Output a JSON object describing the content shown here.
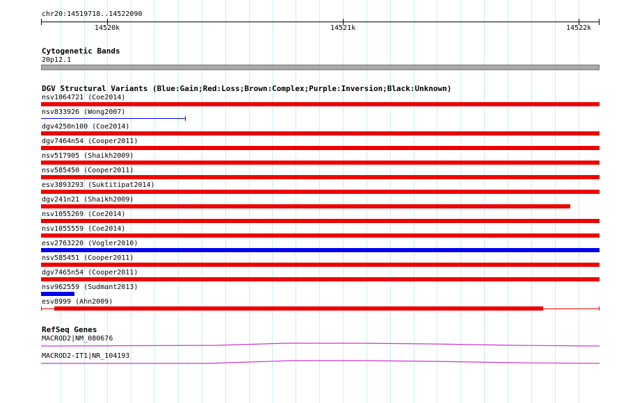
{
  "ruler": {
    "region": "chr20:14519718..14522090",
    "ticks": [
      {
        "label": "14520k",
        "pos": 14520000
      },
      {
        "label": "14521k",
        "pos": 14521000
      },
      {
        "label": "14522k",
        "pos": 14522000
      }
    ]
  },
  "view": {
    "start": 14519718,
    "end": 14522090
  },
  "cytobands": {
    "title": "Cytogenetic Bands",
    "band_label": "20p12.1",
    "band_color": "#a9a9a9"
  },
  "dgv": {
    "title": "DGV Structural Variants (Blue:Gain;Red:Loss;Brown:Complex;Purple:Inversion;Black:Unknown)",
    "colors": {
      "loss": "#ee0000",
      "gain": "#0000ee"
    },
    "variants": [
      {
        "label": "nsv1064721 (Coe2014)",
        "type": "loss",
        "style": "thick",
        "start": 14519718,
        "end": 14522090
      },
      {
        "label": "nsv833926 (Wong2007)",
        "type": "gain",
        "style": "thin",
        "start": 14519718,
        "end": 14520330
      },
      {
        "label": "dgv4250n100 (Coe2014)",
        "type": "loss",
        "style": "thick",
        "start": 14519718,
        "end": 14522090
      },
      {
        "label": "dgv7464n54 (Cooper2011)",
        "type": "loss",
        "style": "thick",
        "start": 14519718,
        "end": 14522090
      },
      {
        "label": "nsv517905 (Shaikh2009)",
        "type": "loss",
        "style": "thick",
        "start": 14519718,
        "end": 14522090
      },
      {
        "label": "nsv585450 (Cooper2011)",
        "type": "loss",
        "style": "thick",
        "start": 14519718,
        "end": 14522090
      },
      {
        "label": "esv3893293 (Suktitipat2014)",
        "type": "loss",
        "style": "thick",
        "start": 14519718,
        "end": 14522090
      },
      {
        "label": "dgv241n21 (Shaikh2009)",
        "type": "loss",
        "style": "thick",
        "start": 14519718,
        "end": 14521965
      },
      {
        "label": "nsv1055269 (Coe2014)",
        "type": "loss",
        "style": "thick",
        "start": 14519718,
        "end": 14522090
      },
      {
        "label": "nsv1055559 (Coe2014)",
        "type": "loss",
        "style": "thick",
        "start": 14519718,
        "end": 14522090
      },
      {
        "label": "esv2763220 (Vogler2010)",
        "type": "gain",
        "style": "thick",
        "start": 14519718,
        "end": 14522090
      },
      {
        "label": "nsv585451 (Cooper2011)",
        "type": "loss",
        "style": "thick",
        "start": 14519718,
        "end": 14522090
      },
      {
        "label": "dgv7465n54 (Cooper2011)",
        "type": "loss",
        "style": "thick",
        "start": 14519718,
        "end": 14522090
      },
      {
        "label": "nsv962559 (Sudmant2013)",
        "type": "gain",
        "style": "thick",
        "start": 14519718,
        "end": 14519860
      },
      {
        "label": "esv8999 (Ahn2009)",
        "type": "loss",
        "style": "split",
        "start": 14519718,
        "end": 14522090,
        "inner_start": 14519775,
        "inner_end": 14521850
      }
    ]
  },
  "refseq": {
    "title": "RefSeq Genes",
    "color": "#cc33cc",
    "genes": [
      {
        "label": "MACROD2|NM_080676"
      },
      {
        "label": "MACROD2-IT1|NR_104193"
      }
    ]
  }
}
